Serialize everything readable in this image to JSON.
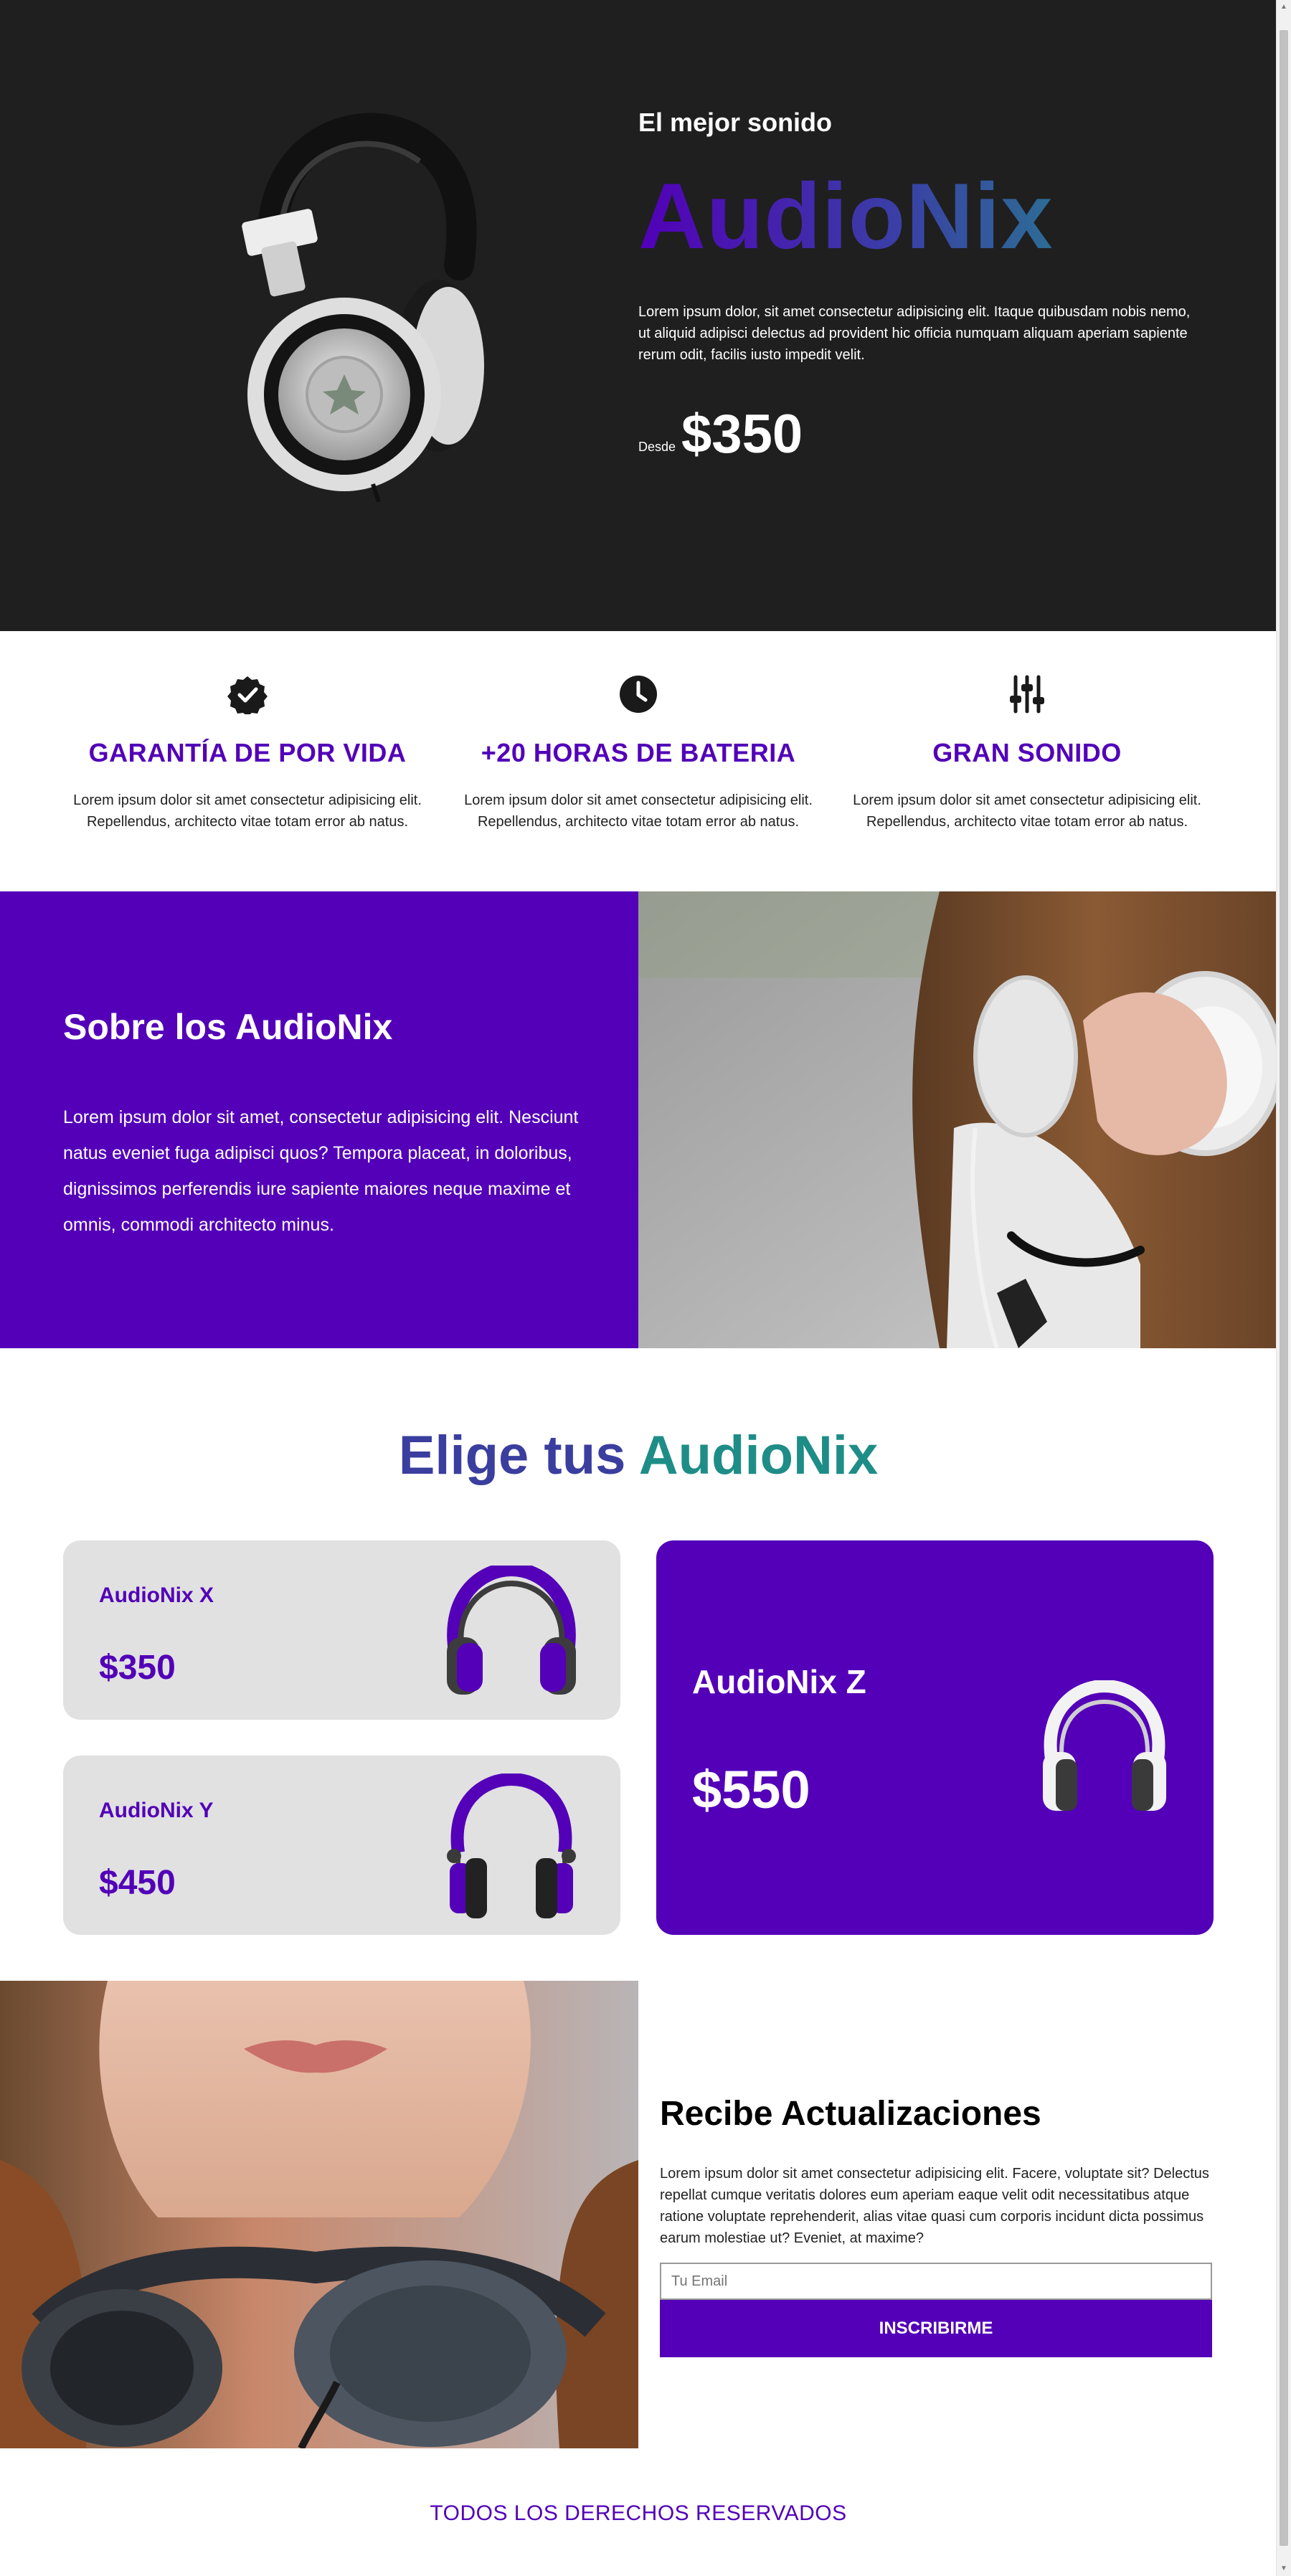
{
  "hero": {
    "kicker": "El mejor sonido",
    "brand": "AudioNix",
    "description": "Lorem ipsum dolor, sit amet consectetur adipisicing elit. Itaque quibusdam nobis nemo, ut aliquid adipisci delectus ad provident hic officia numquam aliquam aperiam sapiente rerum odit, facilis iusto impedit velit.",
    "price_prefix": "Desde",
    "price": "$350"
  },
  "features": [
    {
      "icon": "badge-check-icon",
      "title": "GARANTÍA DE POR VIDA",
      "text": "Lorem ipsum dolor sit amet consectetur adipisicing elit. Repellendus, architecto vitae totam error ab natus."
    },
    {
      "icon": "clock-icon",
      "title": "+20 HORAS DE BATERIA",
      "text": "Lorem ipsum dolor sit amet consectetur adipisicing elit. Repellendus, architecto vitae totam error ab natus."
    },
    {
      "icon": "sliders-icon",
      "title": "GRAN SONIDO",
      "text": "Lorem ipsum dolor sit amet consectetur adipisicing elit. Repellendus, architecto vitae totam error ab natus."
    }
  ],
  "about": {
    "title": "Sobre los AudioNix",
    "text": "Lorem ipsum dolor sit amet, consectetur adipisicing elit. Nesciunt natus eveniet fuga adipisci quos? Tempora placeat, in doloribus, dignissimos perferendis iure sapiente maiores neque maxime et omnis, commodi architecto minus."
  },
  "choose": {
    "title_part1": "Elige tus",
    "title_part2": "AudioNix",
    "products": [
      {
        "name": "AudioNix X",
        "price": "$350"
      },
      {
        "name": "AudioNix Y",
        "price": "$450"
      },
      {
        "name": "AudioNix Z",
        "price": "$550"
      }
    ]
  },
  "newsletter": {
    "title": "Recibe Actualizaciones",
    "text": "Lorem ipsum dolor sit amet consectetur adipisicing elit. Facere, voluptate sit? Delectus repellat cumque veritatis dolores eum aperiam eaque velit odit necessitatibus atque ratione voluptate reprehenderit, alias vitae quasi cum corporis incidunt dicta possimus earum molestiae ut? Eveniet, at maxime?",
    "email_placeholder": "Tu Email",
    "button": "INSCRIBIRME"
  },
  "footer": {
    "text": "TODOS LOS DERECHOS RESERVADOS"
  },
  "colors": {
    "brand_purple": "#5300b8",
    "teal": "#1e8d87",
    "hero_bg": "#1f1f1f",
    "card_gray": "#e1e1e1"
  }
}
